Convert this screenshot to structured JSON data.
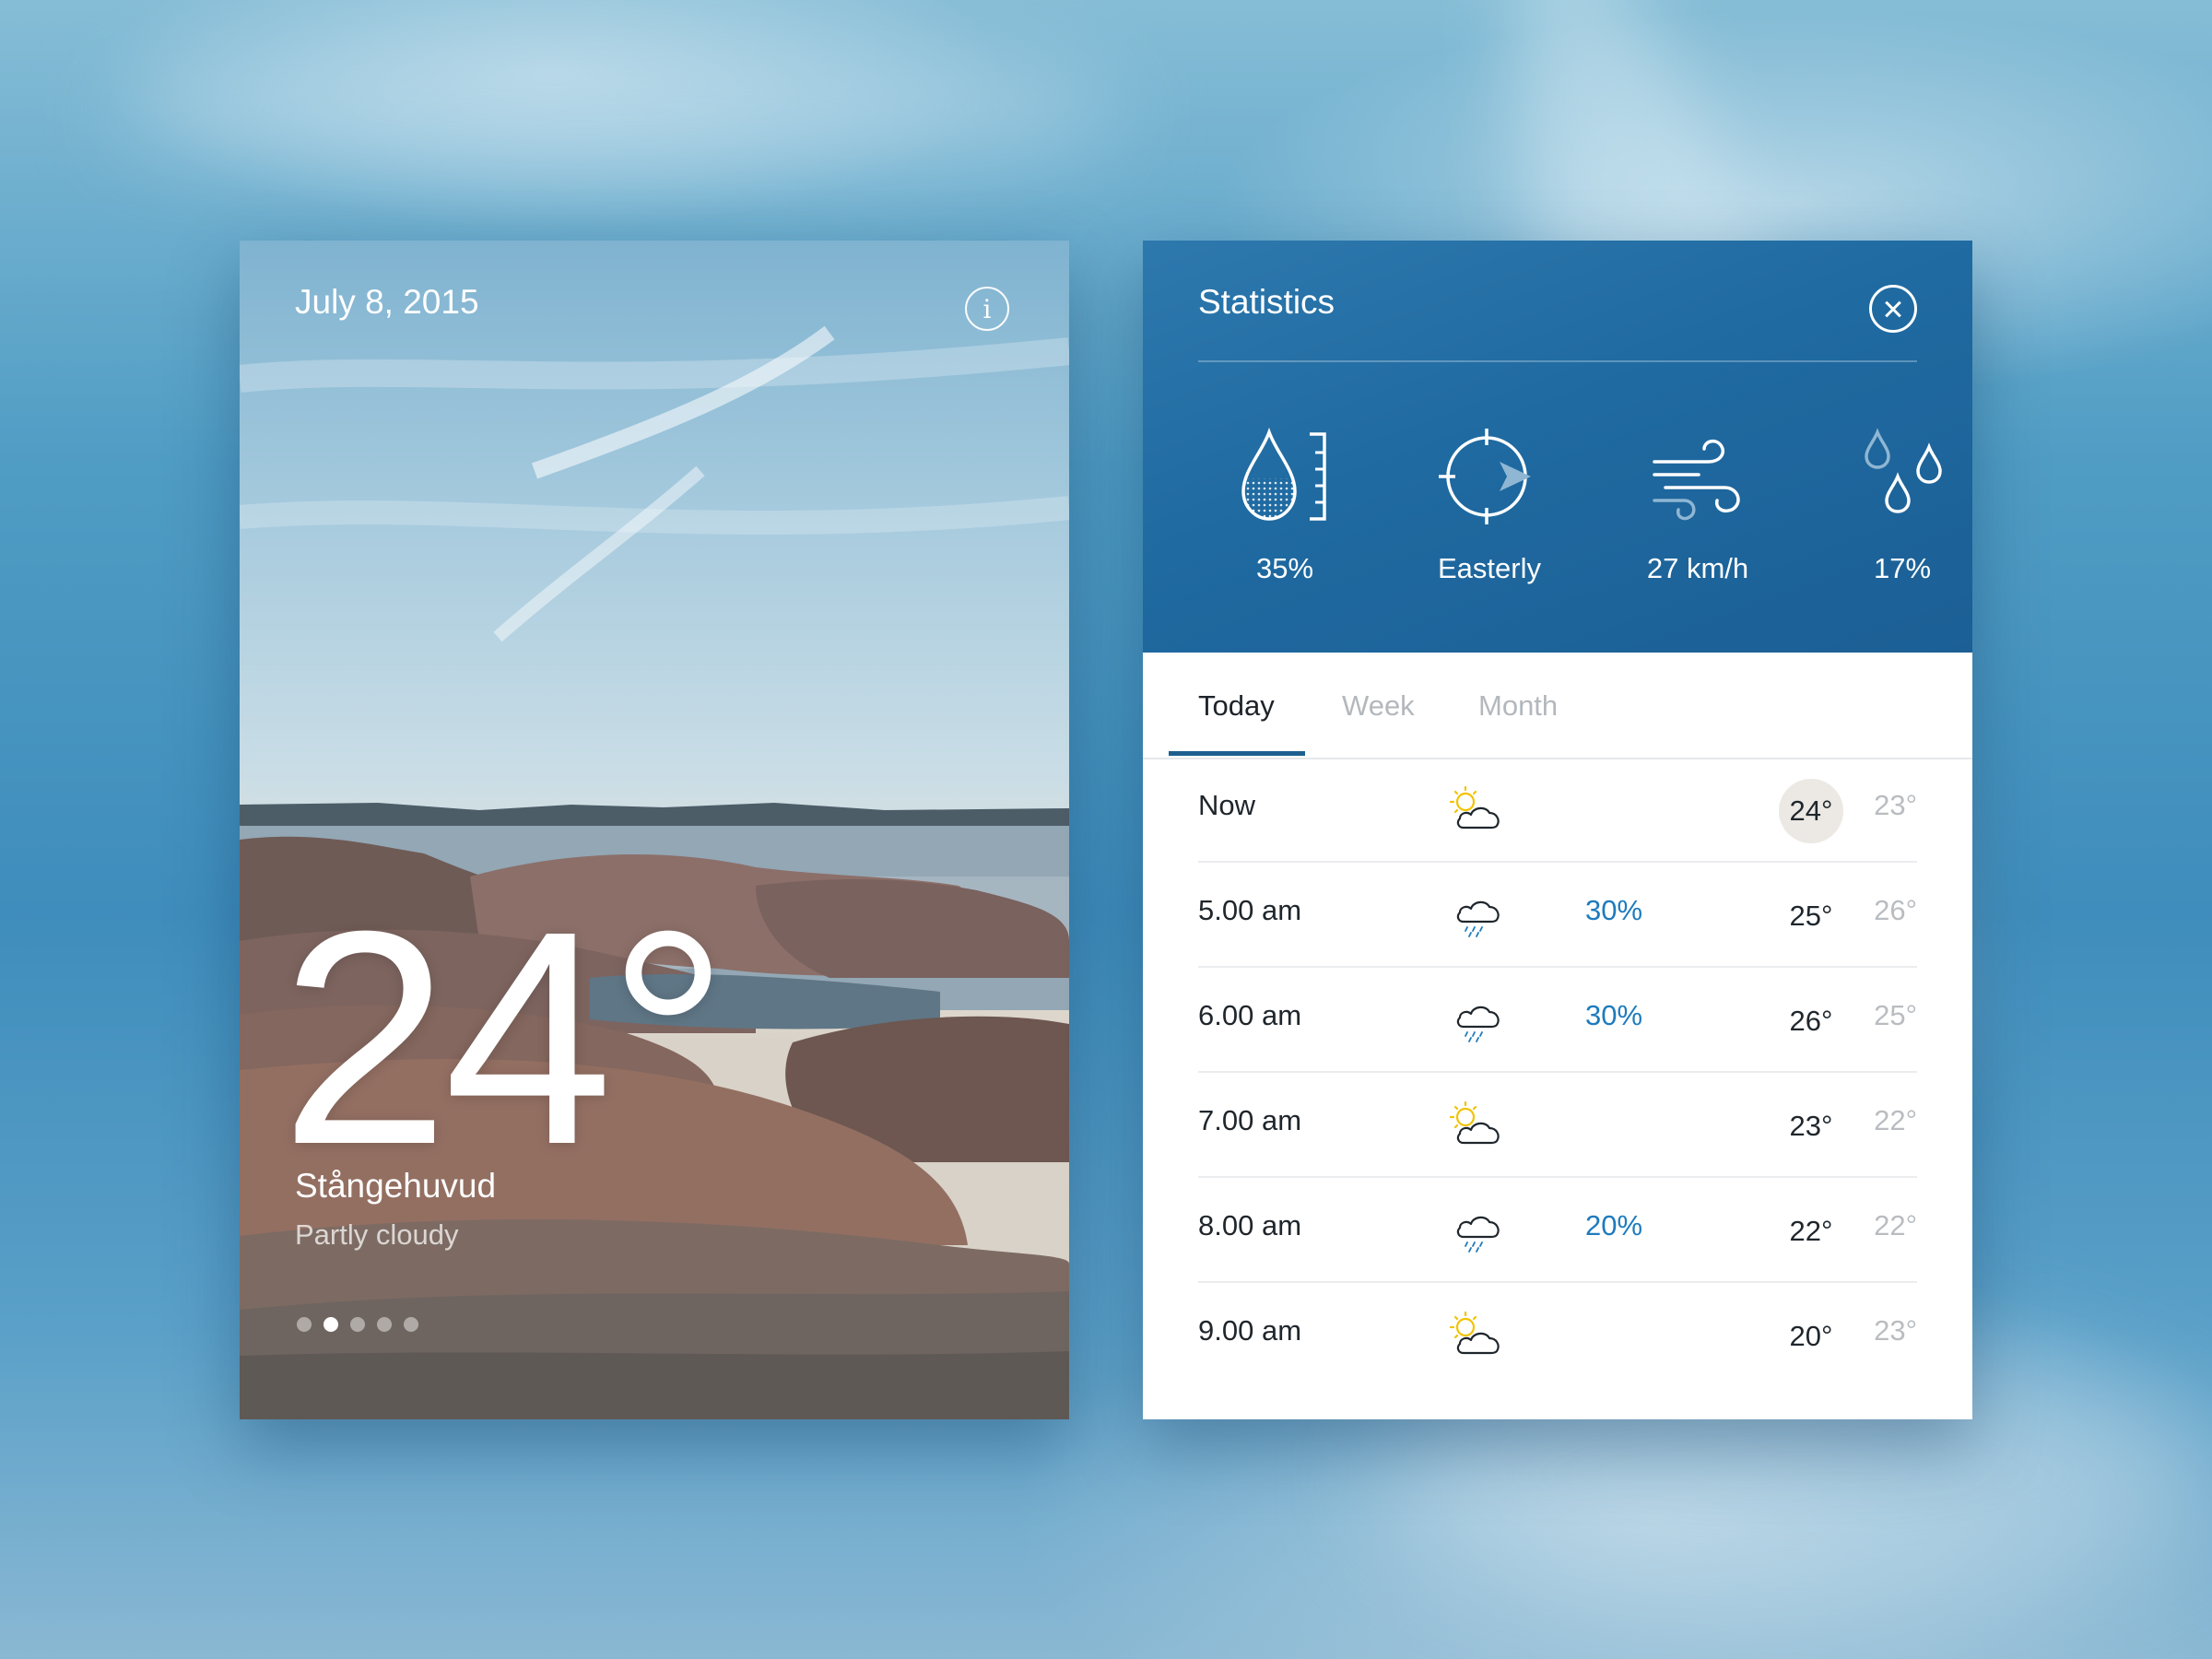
{
  "current": {
    "date": "July 8, 2015",
    "temperature": "24°",
    "location": "Stångehuvud",
    "condition": "Partly cloudy",
    "pages": {
      "count": 5,
      "active_index": 1
    }
  },
  "statistics": {
    "title": "Statistics",
    "metrics": [
      {
        "icon": "humidity-gauge-icon",
        "value": "35%"
      },
      {
        "icon": "compass-icon",
        "value": "Easterly"
      },
      {
        "icon": "wind-icon",
        "value": "27 km/h"
      },
      {
        "icon": "raindrops-icon",
        "value": "17%"
      }
    ],
    "tabs": [
      "Today",
      "Week",
      "Month"
    ],
    "active_tab": "Today",
    "hourly": [
      {
        "time": "Now",
        "icon": "partly-cloudy-icon",
        "precip": "",
        "high": "24°",
        "low": "23°"
      },
      {
        "time": "5.00 am",
        "icon": "rain-cloud-icon",
        "precip": "30%",
        "high": "25°",
        "low": "26°"
      },
      {
        "time": "6.00 am",
        "icon": "rain-cloud-icon",
        "precip": "30%",
        "high": "26°",
        "low": "25°"
      },
      {
        "time": "7.00 am",
        "icon": "partly-cloudy-icon",
        "precip": "",
        "high": "23°",
        "low": "22°"
      },
      {
        "time": "8.00 am",
        "icon": "rain-cloud-icon",
        "precip": "20%",
        "high": "22°",
        "low": "22°"
      },
      {
        "time": "9.00 am",
        "icon": "partly-cloudy-icon",
        "precip": "",
        "high": "20°",
        "low": "23°"
      }
    ]
  },
  "colors": {
    "accent_blue": "#1e7bbd",
    "header_blue": "#1f6aa1",
    "sun_yellow": "#f2c300"
  }
}
